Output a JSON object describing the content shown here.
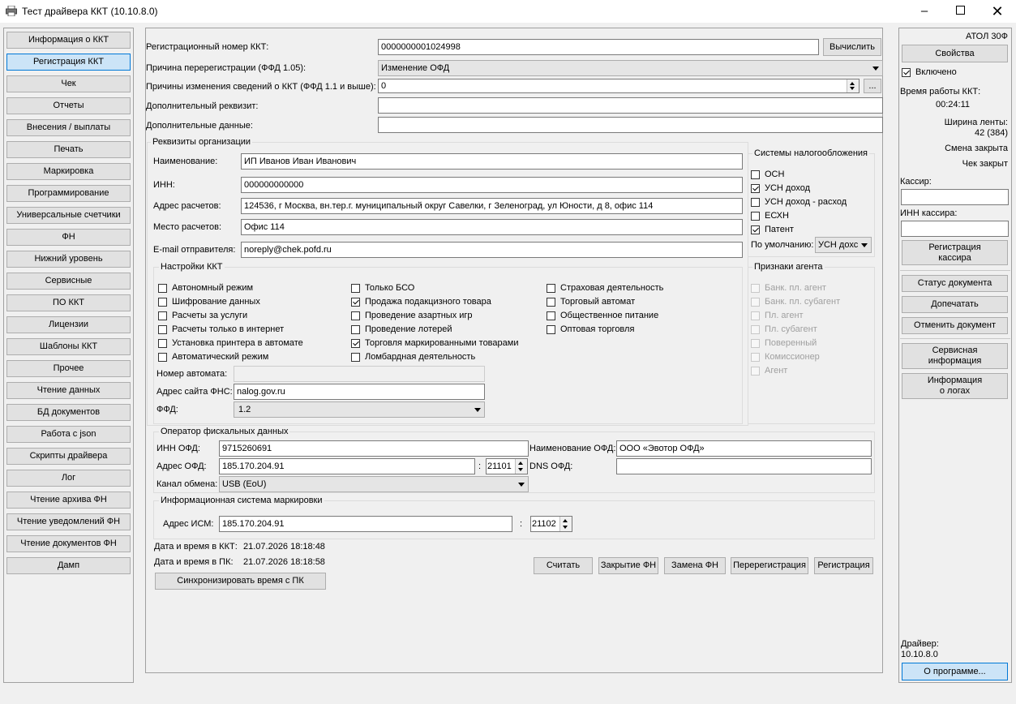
{
  "window": {
    "title": "Тест драйвера ККТ (10.10.8.0)"
  },
  "nav": [
    "Информация о ККТ",
    "Регистрация ККТ",
    "Чек",
    "Отчеты",
    "Внесения / выплаты",
    "Печать",
    "Маркировка",
    "Программирование",
    "Универсальные счетчики",
    "ФН",
    "Нижний уровень",
    "Сервисные",
    "ПО ККТ",
    "Лицензии",
    "Шаблоны ККТ",
    "Прочее",
    "Чтение данных",
    "БД документов",
    "Работа с json",
    "Скрипты драйвера",
    "Лог",
    "Чтение архива ФН",
    "Чтение уведомлений ФН",
    "Чтение документов ФН",
    "Дамп"
  ],
  "nav_selected": 1,
  "top": {
    "reg_number_label": "Регистрационный номер ККТ:",
    "reg_number": "0000000001024998",
    "calc_button": "Вычислить",
    "rereg_reason_label": "Причина перерегистрации (ФФД 1.05):",
    "rereg_reason": "Изменение ОФД",
    "change_reasons_label": "Причины изменения сведений о ККТ (ФФД 1.1 и выше):",
    "change_reasons": "0",
    "ellipsis": "...",
    "extra_requisite_label": "Дополнительный реквизит:",
    "extra_requisite": "",
    "extra_data_label": "Дополнительные данные:",
    "extra_data": ""
  },
  "org": {
    "title": "Реквизиты организации",
    "name_label": "Наименование:",
    "name": "ИП Иванов Иван Иванович",
    "inn_label": "ИНН:",
    "inn": "000000000000",
    "address_label": "Адрес расчетов:",
    "address": "124536, г Москва, вн.тер.г. муниципальный округ Савелки, г Зеленоград, ул Юности, д 8, офис 114",
    "place_label": "Место расчетов:",
    "place": "Офис 114",
    "email_label": "E-mail отправителя:",
    "email": "noreply@chek.pofd.ru"
  },
  "tax": {
    "title": "Системы налогообложения",
    "items": [
      {
        "label": "ОСН",
        "checked": false
      },
      {
        "label": "УСН доход",
        "checked": true
      },
      {
        "label": "УСН доход - расход",
        "checked": false
      },
      {
        "label": "ЕСХН",
        "checked": false
      },
      {
        "label": "Патент",
        "checked": true
      }
    ],
    "default_label": "По умолчанию:",
    "default_value": "УСН дохс"
  },
  "kkt": {
    "title": "Настройки ККТ",
    "col1": [
      {
        "label": "Автономный режим",
        "checked": false
      },
      {
        "label": "Шифрование данных",
        "checked": false
      },
      {
        "label": "Расчеты за услуги",
        "checked": false
      },
      {
        "label": "Расчеты только в интернет",
        "checked": false
      },
      {
        "label": "Установка принтера в автомате",
        "checked": false
      },
      {
        "label": "Автоматический режим",
        "checked": false
      }
    ],
    "col2": [
      {
        "label": "Только БСО",
        "checked": false
      },
      {
        "label": "Продажа подакцизного товара",
        "checked": true
      },
      {
        "label": "Проведение азартных игр",
        "checked": false
      },
      {
        "label": "Проведение лотерей",
        "checked": false
      },
      {
        "label": "Торговля маркированными товарами",
        "checked": true
      },
      {
        "label": "Ломбардная деятельность",
        "checked": false
      }
    ],
    "col3": [
      {
        "label": "Страховая деятельность",
        "checked": false
      },
      {
        "label": "Торговый автомат",
        "checked": false
      },
      {
        "label": "Общественное питание",
        "checked": false
      },
      {
        "label": "Оптовая торговля",
        "checked": false
      }
    ],
    "automat_label": "Номер автомата:",
    "automat": "",
    "fns_label": "Адрес сайта ФНС:",
    "fns": "nalog.gov.ru",
    "ffd_label": "ФФД:",
    "ffd": "1.2"
  },
  "agent": {
    "title": "Признаки агента",
    "items": [
      "Банк. пл. агент",
      "Банк. пл. субагент",
      "Пл. агент",
      "Пл. субагент",
      "Поверенный",
      "Комиссионер",
      "Агент"
    ]
  },
  "ofd": {
    "title": "Оператор фискальных данных",
    "inn_label": "ИНН ОФД:",
    "inn": "9715260691",
    "name_label": "Наименование ОФД:",
    "name": "ООО «Эвотор ОФД»",
    "addr_label": "Адрес ОФД:",
    "addr": "185.170.204.91",
    "colon": ":",
    "port": "21101",
    "dns_label": "DNS ОФД:",
    "dns": "",
    "channel_label": "Канал обмена:",
    "channel": "USB (EoU)"
  },
  "ism": {
    "title": "Информационная система маркировки",
    "addr_label": "Адрес ИСМ:",
    "addr": "185.170.204.91",
    "colon": ":",
    "port": "21102"
  },
  "times": {
    "kkt_label": "Дата и время в ККТ:",
    "kkt": "21.07.2026 18:18:48",
    "pc_label": "Дата и время в ПК:",
    "pc": "21.07.2026 18:18:58",
    "sync_button": "Синхронизировать время с ПК"
  },
  "actions": [
    "Считать",
    "Закрытие ФН",
    "Замена ФН",
    "Перерегистрация",
    "Регистрация"
  ],
  "side": {
    "device": "АТОЛ 30Ф",
    "props_button": "Свойства",
    "enabled_label": "Включено",
    "uptime_label": "Время работы ККТ:",
    "uptime": "00:24:11",
    "tape_label": "Ширина ленты:",
    "tape": "42 (384)",
    "shift": "Смена закрыта",
    "check": "Чек закрыт",
    "cashier_label": "Кассир:",
    "cashier": "",
    "cashier_inn_label": "ИНН кассира:",
    "cashier_inn": "",
    "reg_cashier_line1": "Регистрация",
    "reg_cashier_line2": "кассира",
    "doc_status": "Статус документа",
    "reprint": "Допечатать",
    "cancel_doc": "Отменить документ",
    "service_line1": "Сервисная",
    "service_line2": "информация",
    "logs_line1": "Информация",
    "logs_line2": "о логах",
    "driver_label": "Драйвер:",
    "driver_version": "10.10.8.0",
    "about": "О программе..."
  }
}
